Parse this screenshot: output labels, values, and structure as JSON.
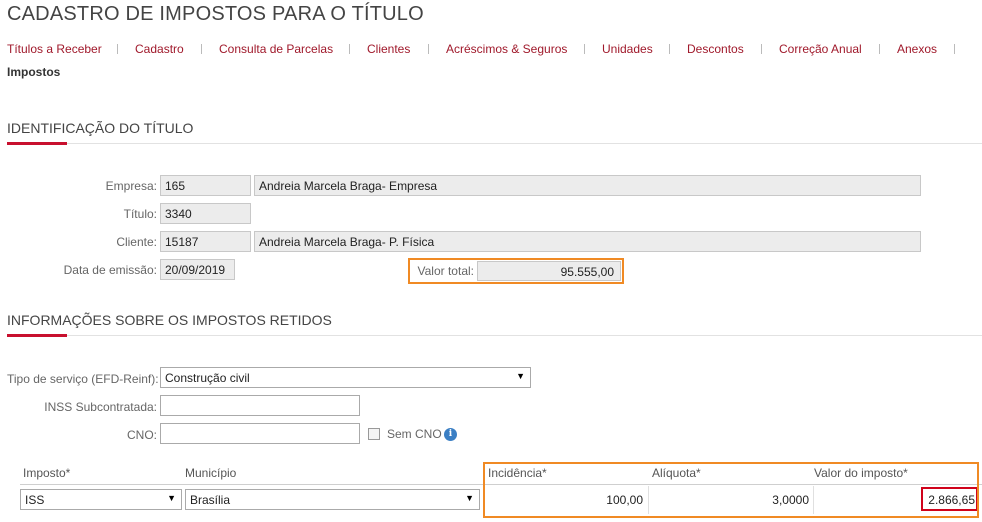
{
  "page": {
    "title": "CADASTRO DE IMPOSTOS PARA O TÍTULO"
  },
  "nav": {
    "items": [
      "Títulos a Receber",
      "Cadastro",
      "Consulta de Parcelas",
      "Clientes",
      "Acréscimos & Seguros",
      "Unidades",
      "Descontos",
      "Correção Anual",
      "Anexos"
    ],
    "active": "Impostos"
  },
  "identificacao": {
    "section_title": "IDENTIFICAÇÃO DO TÍTULO",
    "empresa_label": "Empresa:",
    "empresa_code": "165",
    "empresa_name": "Andreia Marcela Braga- Empresa",
    "titulo_label": "Título:",
    "titulo_value": "3340",
    "cliente_label": "Cliente:",
    "cliente_code": "15187",
    "cliente_name": "Andreia Marcela Braga- P. Física",
    "emissao_label": "Data de emissão:",
    "emissao_value": "20/09/2019",
    "valor_total_label": "Valor total:",
    "valor_total_value": "95.555,00"
  },
  "impostos": {
    "section_title": "INFORMAÇÕES SOBRE OS IMPOSTOS RETIDOS",
    "tipo_servico_label": "Tipo de serviço (EFD-Reinf):",
    "tipo_servico_value": "Construção civil",
    "inss_label": "INSS Subcontratada:",
    "inss_value": "",
    "cno_label": "CNO:",
    "cno_value": "",
    "sem_cno_label": "Sem CNO",
    "sem_cno_checked": false,
    "table": {
      "headers": {
        "imposto": "Imposto*",
        "municipio": "Município",
        "incidencia": "Incidência*",
        "aliquota": "Alíquota*",
        "valor": "Valor do imposto*"
      },
      "rows": [
        {
          "imposto": "ISS",
          "municipio": "Brasília",
          "incidencia": "100,00",
          "aliquota": "3,0000",
          "valor": "2.866,65"
        }
      ]
    }
  },
  "colors": {
    "accent_red": "#c8102e",
    "nav_link": "#a0192b",
    "highlight_orange": "#f08a24",
    "highlight_red": "#d0021b",
    "info_blue": "#3b7fc4"
  },
  "icons": {
    "dropdown": "caret-down-icon",
    "info": "info-icon",
    "checkbox": "checkbox-icon"
  }
}
